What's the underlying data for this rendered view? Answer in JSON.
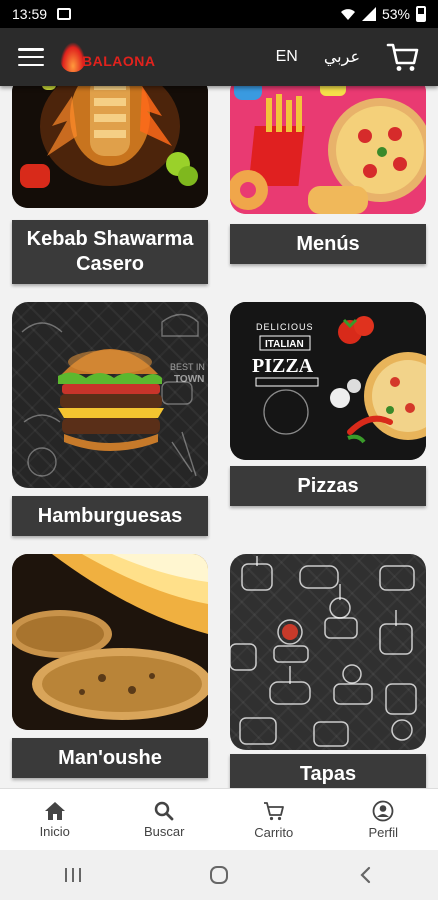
{
  "status_bar": {
    "time": "13:59",
    "battery": "53%"
  },
  "header": {
    "brand": "BALAONA",
    "lang_en": "EN",
    "lang_ar": "عربي"
  },
  "categories": [
    {
      "label": "Kebab Shawarma Casero"
    },
    {
      "label": "Menús"
    },
    {
      "label": "Hamburguesas"
    },
    {
      "label": "Pizzas"
    },
    {
      "label": "Man'oushe"
    },
    {
      "label": "Tapas"
    }
  ],
  "thumb_text": {
    "pizza_small": "DELICIOUS",
    "pizza_mid": "ITALIAN",
    "pizza_big": "PIZZA",
    "burger_line1": "BEST IN",
    "burger_line2": "TOWN"
  },
  "bottom_nav": [
    {
      "label": "Inicio",
      "icon": "home-icon"
    },
    {
      "label": "Buscar",
      "icon": "search-icon"
    },
    {
      "label": "Carrito",
      "icon": "cart-icon"
    },
    {
      "label": "Perfil",
      "icon": "profile-icon"
    }
  ],
  "colors": {
    "header_bg": "#2b2b2b",
    "brand_red": "#e0221d",
    "label_bg": "#3a3a3a"
  }
}
